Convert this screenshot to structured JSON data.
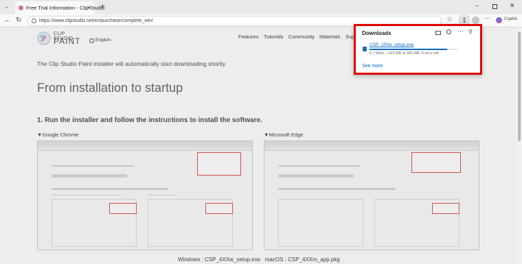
{
  "tab": {
    "title": "Free Trial Information - Clip Studio"
  },
  "address": {
    "url": "https://www.clipstudio.net/en/purchase/complete_win/"
  },
  "toolbar": {
    "copilot_label": "Copilot"
  },
  "site": {
    "logo_top": "CLIP STUDIO",
    "logo_bottom": "PAINT",
    "language": "English",
    "nav": [
      "Features",
      "Tutorials",
      "Community",
      "Materials",
      "Sup"
    ]
  },
  "content": {
    "intro": "The Clip Studio Paint installer will automatically start downloading shortly.",
    "heading": "From installation to startup",
    "step1": "1. Run the installer and follow the instructions to install the software.",
    "chrome_label": "▼Google Chrome",
    "edge_label": "▼Microsoft Edge",
    "files": {
      "windows_label": "Windows",
      "windows_file": "CSP_4XXw_setup.exe",
      "mac_label": "macOS",
      "mac_file": "CSP_4XXm_app.pkg"
    }
  },
  "downloads": {
    "title": "Downloads",
    "filename": "CSP_200w_setup.exe",
    "status": "6.7 Mb/s – 322 MB of 365 MB, 6 secs left",
    "progress": 0.88,
    "see_more": "See more"
  },
  "colors": {
    "accent": "#0067c0",
    "highlight": "#e00000"
  }
}
